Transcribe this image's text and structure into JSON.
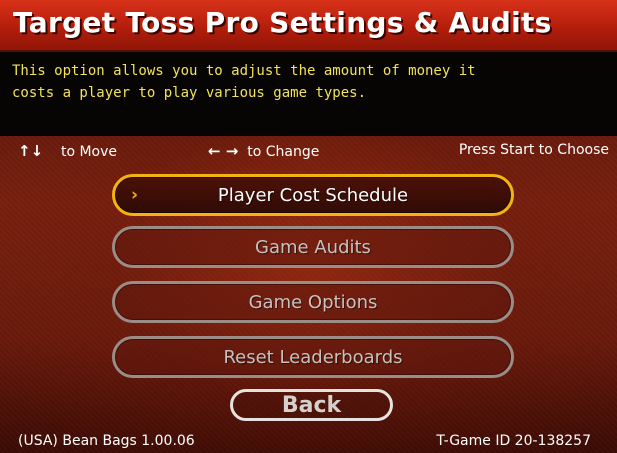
{
  "header": {
    "title": "Target Toss Pro Settings & Audits"
  },
  "description": {
    "line1": "This option allows you to adjust the amount of money it",
    "line2": "costs a player to play various game types."
  },
  "hints": {
    "move_icon": "↑↓",
    "move_label": "to Move",
    "change_icon": "← →",
    "change_label": "to Change",
    "choose_label": "Press Start to Choose"
  },
  "menu": {
    "items": [
      {
        "label": "Player Cost Schedule",
        "selected": true
      },
      {
        "label": "Game Audits",
        "selected": false
      },
      {
        "label": "Game Options",
        "selected": false
      },
      {
        "label": "Reset Leaderboards",
        "selected": false
      }
    ],
    "selection_marker": "›",
    "back_label": "Back"
  },
  "footer": {
    "version": "(USA) Bean Bags 1.00.06",
    "game_id": "T-Game ID 20-138257"
  },
  "colors": {
    "title_bar": "#c8260f",
    "description_text": "#f2e35a",
    "selected_border": "#f3b40f",
    "button_border": "#9a8c86",
    "background": "#6a1a0b"
  }
}
